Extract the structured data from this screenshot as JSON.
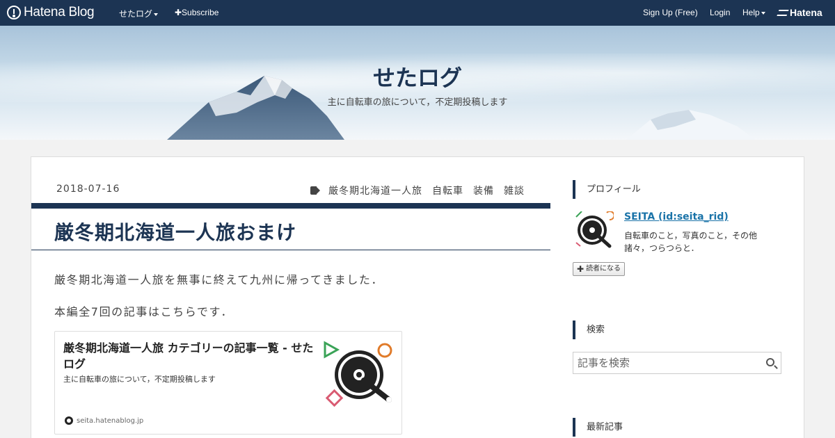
{
  "topbar": {
    "logo_text": "Hatena Blog",
    "blog_menu": "せたログ",
    "subscribe": "✚Subscribe",
    "signup": "Sign Up (Free)",
    "login": "Login",
    "help": "Help",
    "hatena": "Hatena"
  },
  "header": {
    "title": "せたログ",
    "description": "主に自転車の旅について，不定期投稿します"
  },
  "article": {
    "date": "2018-07-16",
    "tags": [
      "厳冬期北海道一人旅",
      "自転車",
      "装備",
      "雑談"
    ],
    "title": "厳冬期北海道一人旅おまけ",
    "paragraph1": "厳冬期北海道一人旅を無事に終えて九州に帰ってきました．",
    "paragraph2": "本編全7回の記事はこちらです．"
  },
  "embed": {
    "title": "厳冬期北海道一人旅 カテゴリーの記事一覧 - せたログ",
    "description": "主に自転車の旅について，不定期投稿します",
    "site": "seita.hatenablog.jp"
  },
  "sidebar": {
    "profile_heading": "プロフィール",
    "profile_name": "SEITA (id:seita_rid)",
    "profile_desc": "自転車のこと，写真のこと，その他諸々，つらつらと．",
    "follow_button": "読者になる",
    "search_heading": "検索",
    "search_placeholder": "記事を検索",
    "recent_heading": "最新記事"
  },
  "colors": {
    "navy": "#1c3453",
    "link": "#1a73a8"
  }
}
